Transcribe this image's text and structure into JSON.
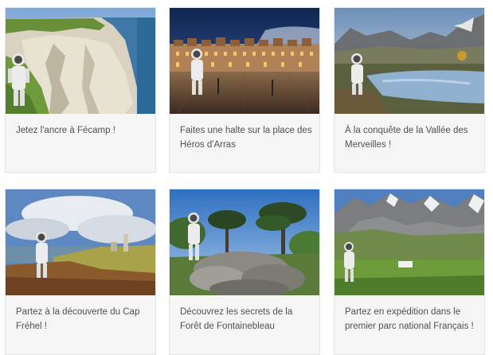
{
  "cards": [
    {
      "caption": "Jetez l'ancre à Fécamp !"
    },
    {
      "caption": "Faites une halte sur la place des Héros d'Arras"
    },
    {
      "caption": "À la conquête de la Vallée des Merveilles !"
    },
    {
      "caption": "Partez à la découverte du Cap Fréhel !"
    },
    {
      "caption": "Découvrez les secrets de la Forêt de Fontainebleau"
    },
    {
      "caption": "Partez en expédition dans le premier parc national Français !"
    }
  ]
}
